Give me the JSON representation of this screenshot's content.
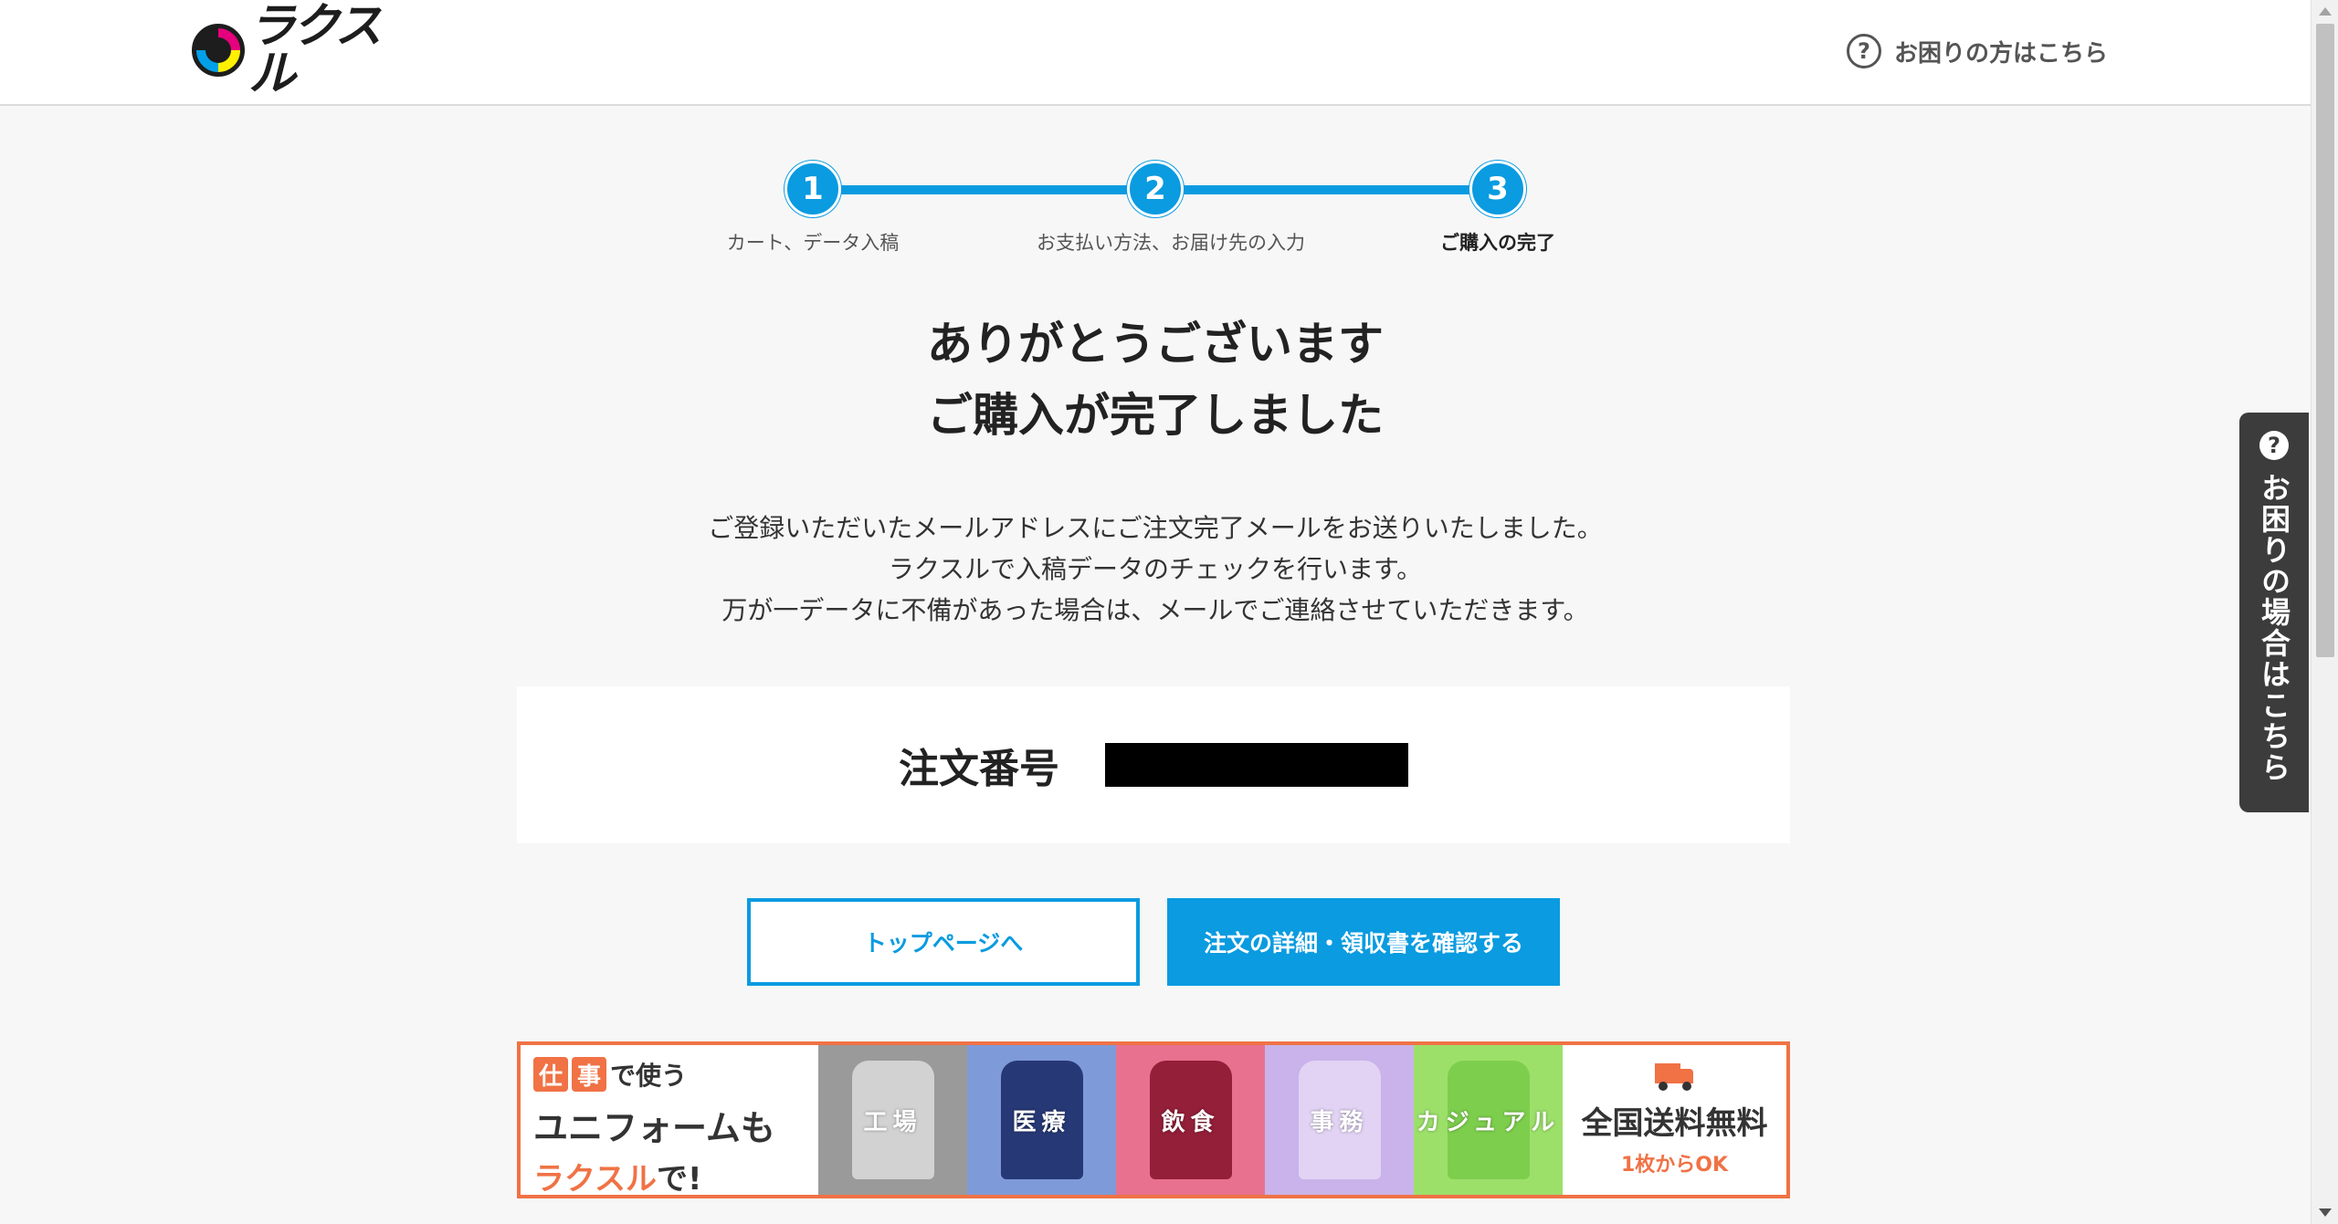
{
  "header": {
    "logo_text": "ラクスル",
    "help_label": "お困りの方はこちら"
  },
  "stepper": {
    "steps": [
      {
        "number": "1",
        "label": "カート、データ入稿"
      },
      {
        "number": "2",
        "label": "お支払い方法、お届け先の入力"
      },
      {
        "number": "3",
        "label": "ご購入の完了"
      }
    ],
    "current_step": 3
  },
  "main": {
    "heading_line1": "ありがとうございます",
    "heading_line2": "ご購入が完了しました",
    "desc_line1": "ご登録いただいたメールアドレスにご注文完了メールをお送りいたしました。",
    "desc_line2": "ラクスルで入稿データのチェックを行います。",
    "desc_line3": "万が一データに不備があった場合は、メールでご連絡させていただきます。",
    "order_label": "注文番号",
    "order_value": ""
  },
  "buttons": {
    "top_page": "トップページへ",
    "order_detail": "注文の詳細・領収書を確認する"
  },
  "banner": {
    "tag1": "仕",
    "tag2": "事",
    "line1_suffix": "で使う",
    "line2": "ユニフォームも",
    "line3_accent": "ラクスル",
    "line3_suffix": "で!",
    "categories": [
      {
        "label": "工場",
        "color": "#9a9a9a",
        "garment": "#d8d8d8"
      },
      {
        "label": "医療",
        "color": "#7f9ad8",
        "garment": "#1d2d6a"
      },
      {
        "label": "飲食",
        "color": "#e8718f",
        "garment": "#8a1630"
      },
      {
        "label": "事務",
        "color": "#c9b3ea",
        "garment": "#e4d6f5"
      },
      {
        "label": "カジュアル",
        "color": "#9ce06a",
        "garment": "#7acc4a"
      }
    ],
    "right_line1": "全国送料無料",
    "right_line2": "1枚からOK",
    "accent_color": "#f07245"
  },
  "side_tab": {
    "label": "お困りの場合はこちら"
  },
  "colors": {
    "primary": "#0a9be0"
  }
}
